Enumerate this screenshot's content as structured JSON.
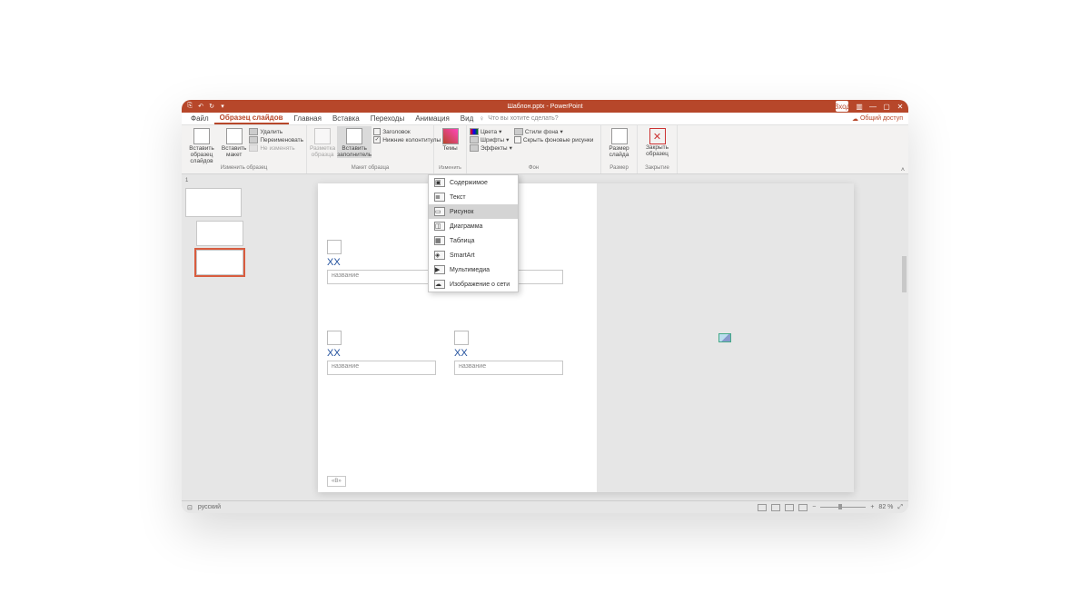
{
  "titlebar": {
    "qat": {
      "save": "⎘",
      "undo": "↶",
      "redo": "↻",
      "more": "▾"
    },
    "title": "Шаблон.pptx - PowerPoint",
    "login": "Вход",
    "ribbonopts": "▥",
    "min": "—",
    "max": "▢",
    "close": "✕"
  },
  "tabs": {
    "file": "Файл",
    "master": "Образец слайдов",
    "home": "Главная",
    "insert": "Вставка",
    "transitions": "Переходы",
    "animations": "Анимация",
    "view": "Вид",
    "bulb": "♀",
    "tellme": "Что вы хотите сделать?",
    "share": "Общий доступ"
  },
  "ribbon": {
    "g_edit": {
      "insertMaster": "Вставить образец слайдов",
      "insertLayout": "Вставить макет",
      "delete": "Удалить",
      "rename": "Переименовать",
      "preserve": "Не изменять",
      "label": "Изменить образец"
    },
    "g_layout": {
      "masterLayout": "Разметка образца",
      "insertPH": "Вставить заполнитель",
      "title": "Заголовок",
      "footers": "Нижние колонтитулы",
      "label": "Макет образца"
    },
    "g_theme": {
      "themes": "Темы",
      "label": "Изменить тему"
    },
    "g_bg": {
      "colors": "Цвета",
      "fonts": "Шрифты",
      "effects": "Эффекты",
      "bgstyles": "Стили фона",
      "hidebg": "Скрыть фоновые рисунки",
      "label": "Фон"
    },
    "g_size": {
      "slidesize": "Размер слайда",
      "label": "Размер"
    },
    "g_close": {
      "close": "Закрыть образец",
      "label": "Закрытие"
    }
  },
  "dropdown": {
    "items": [
      {
        "icon": "▣",
        "label": "Содержимое"
      },
      {
        "icon": "≣",
        "label": "Текст"
      },
      {
        "icon": "▭",
        "label": "Рисунок",
        "hl": true
      },
      {
        "icon": "◫",
        "label": "Диаграмма"
      },
      {
        "icon": "▦",
        "label": "Таблица"
      },
      {
        "icon": "◈",
        "label": "SmartArt"
      },
      {
        "icon": "▶",
        "label": "Мультимедиа"
      },
      {
        "icon": "☁",
        "label": "Изображение о сети"
      }
    ]
  },
  "slide": {
    "xx": "XX",
    "field": "название",
    "small": "«В»"
  },
  "statusbar": {
    "pagelabel": "⊡",
    "lang": "русский",
    "zoom": "82 %",
    "fit": "⤢"
  },
  "thumbnum": "1"
}
